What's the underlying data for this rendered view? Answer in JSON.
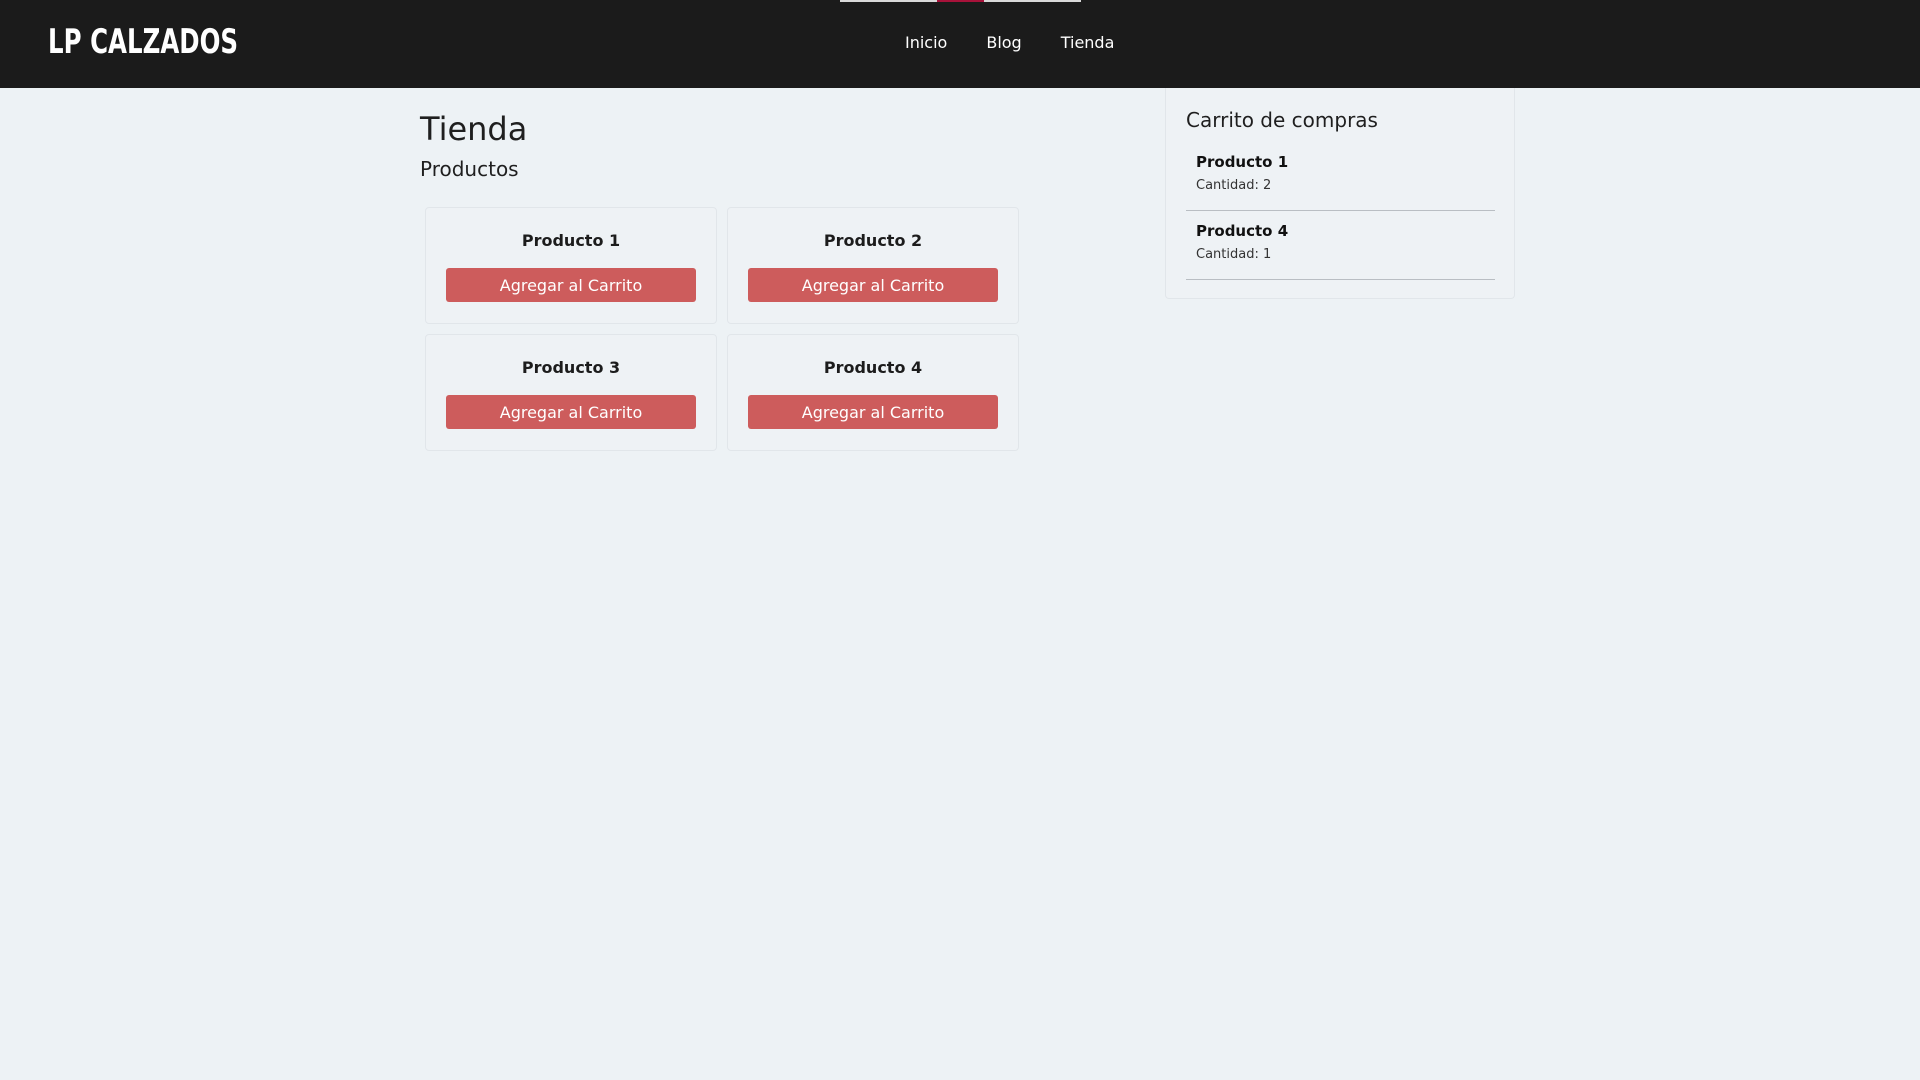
{
  "header": {
    "logo": "LP CALZADOS",
    "nav": [
      "Inicio",
      "Blog",
      "Tienda"
    ]
  },
  "main": {
    "title": "Tienda",
    "subtitle": "Productos",
    "products": [
      {
        "name": "Producto 1",
        "button": "Agregar al Carrito"
      },
      {
        "name": "Producto 2",
        "button": "Agregar al Carrito"
      },
      {
        "name": "Producto 3",
        "button": "Agregar al Carrito"
      },
      {
        "name": "Producto 4",
        "button": "Agregar al Carrito"
      }
    ]
  },
  "cart": {
    "title": "Carrito de compras",
    "items": [
      {
        "name": "Producto 1",
        "quantity": "Cantidad: 2"
      },
      {
        "name": "Producto 4",
        "quantity": "Cantidad: 1"
      }
    ]
  },
  "colors": {
    "header_bg": "#1b1b1b",
    "page_bg": "#edf2f5",
    "button_bg": "#cd5c5c",
    "nav_accent": "#a8123a"
  }
}
